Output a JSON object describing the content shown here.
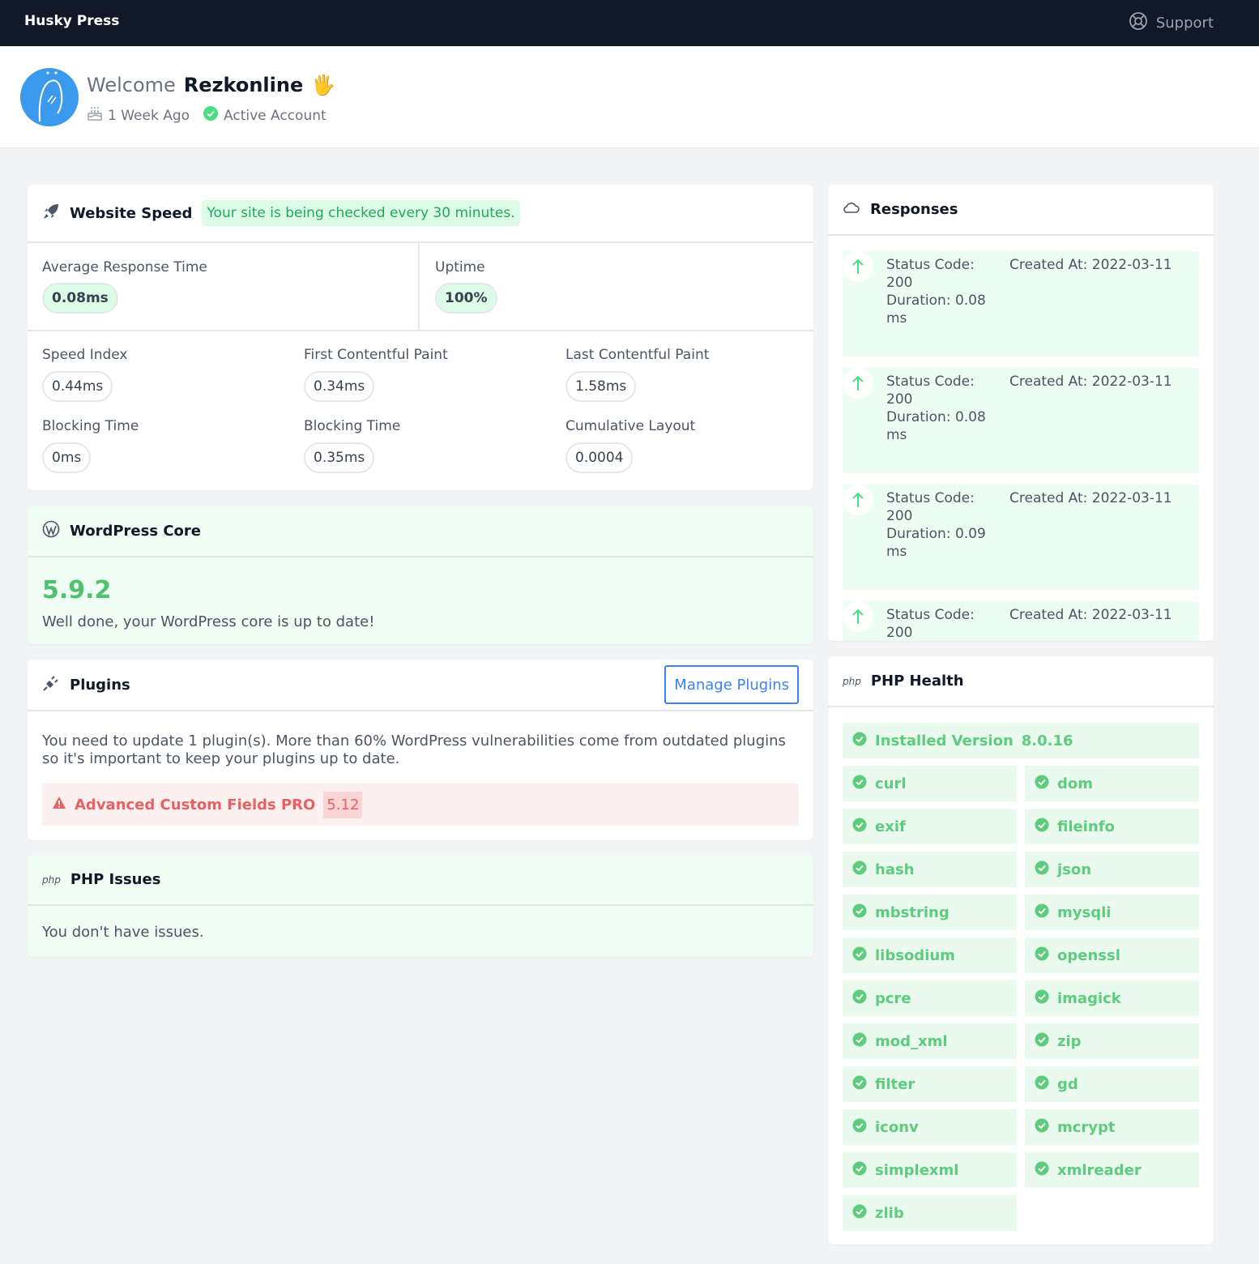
{
  "app": {
    "brand": "Husky Press",
    "support_label": "Support"
  },
  "welcome": {
    "greeting": "Welcome",
    "username": "Rezkonline",
    "emoji": "🖐",
    "age": "1 Week Ago",
    "status": "Active Account"
  },
  "speed": {
    "title": "Website Speed",
    "notice": "Your site is being checked every 30 minutes.",
    "avg_label": "Average Response Time",
    "avg_value": "0.08ms",
    "uptime_label": "Uptime",
    "uptime_value": "100%",
    "metrics": [
      {
        "label": "Speed Index",
        "value": "0.44ms"
      },
      {
        "label": "First Contentful Paint",
        "value": "0.34ms"
      },
      {
        "label": "Last Contentful Paint",
        "value": "1.58ms"
      },
      {
        "label": "Blocking Time",
        "value": "0ms"
      },
      {
        "label": "Blocking Time",
        "value": "0.35ms"
      },
      {
        "label": "Cumulative Layout",
        "value": "0.0004"
      }
    ]
  },
  "core": {
    "title": "WordPress Core",
    "version": "5.9.2",
    "message": "Well done, your WordPress core is up to date!"
  },
  "plugins": {
    "title": "Plugins",
    "manage_label": "Manage Plugins",
    "message": "You need to update 1 plugin(s). More than 60% WordPress vulnerabilities come from outdated plugins so it's important to keep your plugins up to date.",
    "outdated": {
      "name": "Advanced Custom Fields PRO",
      "version": "5.12"
    }
  },
  "php_issues": {
    "icon_text": "php",
    "title": "PHP Issues",
    "message": "You don't have issues."
  },
  "responses": {
    "title": "Responses",
    "items": [
      {
        "code_label": "Status Code:",
        "code": "200",
        "duration_label": "Duration: 0.08",
        "duration_unit": "ms",
        "created": "Created At: 2022-03-11"
      },
      {
        "code_label": "Status Code:",
        "code": "200",
        "duration_label": "Duration: 0.08",
        "duration_unit": "ms",
        "created": "Created At: 2022-03-11"
      },
      {
        "code_label": "Status Code:",
        "code": "200",
        "duration_label": "Duration: 0.09",
        "duration_unit": "ms",
        "created": "Created At: 2022-03-11"
      },
      {
        "code_label": "Status Code:",
        "code": "200",
        "duration_label": "",
        "duration_unit": "",
        "created": "Created At: 2022-03-11"
      }
    ]
  },
  "php_health": {
    "icon_text": "php",
    "title": "PHP Health",
    "installed_label": "Installed Version",
    "installed_value": "8.0.16",
    "extensions": [
      "curl",
      "dom",
      "exif",
      "fileinfo",
      "hash",
      "json",
      "mbstring",
      "mysqli",
      "libsodium",
      "openssl",
      "pcre",
      "imagick",
      "mod_xml",
      "zip",
      "filter",
      "gd",
      "iconv",
      "mcrypt",
      "simplexml",
      "xmlreader",
      "zlib"
    ]
  },
  "colors": {
    "topbar": "#111827",
    "success": "#4ade80",
    "success_bg": "#f0fdf4",
    "danger": "#ef4444",
    "link": "#3b82f6"
  }
}
